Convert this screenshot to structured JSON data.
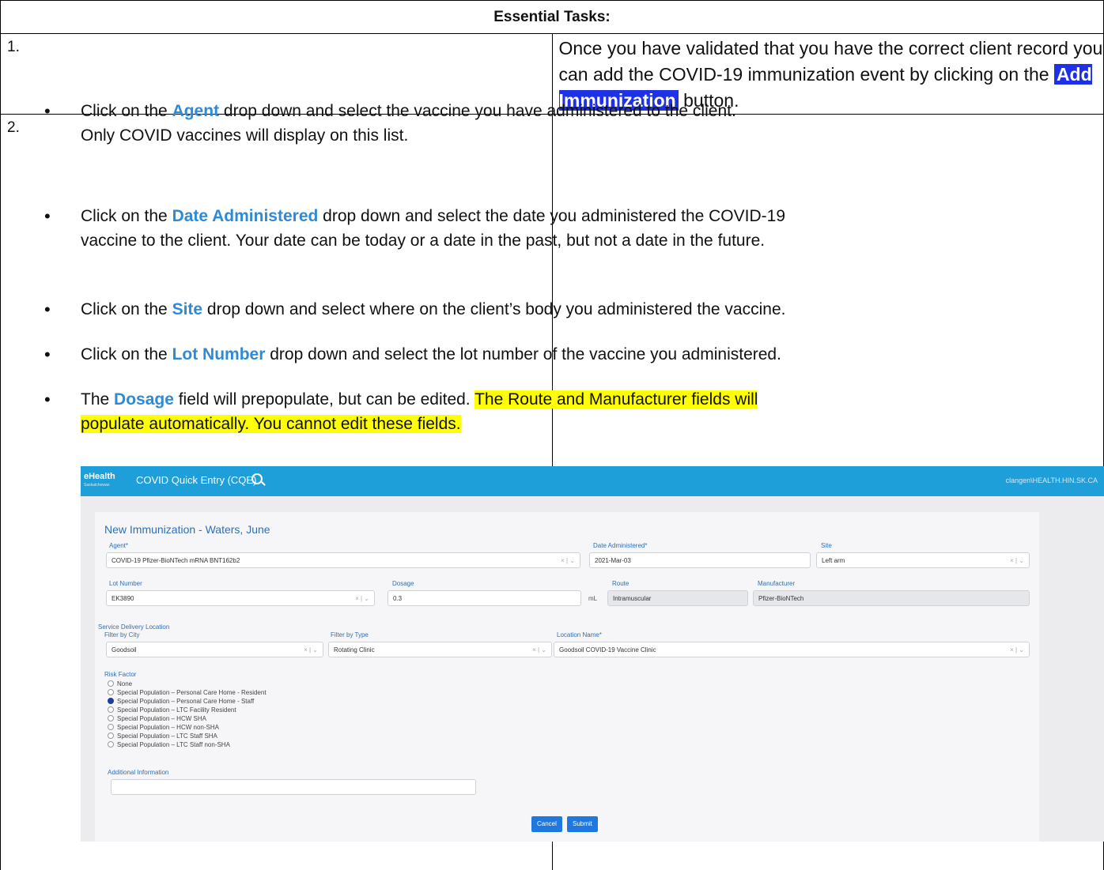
{
  "header": "Essential Tasks:",
  "step1": {
    "number": "1.",
    "text_before": "Once you have validated that you have the correct client record you can add the COVID-19 immunization event by clicking on the ",
    "button": "Add Immunization",
    "text_after": " button."
  },
  "step2": {
    "number": "2.",
    "b1": {
      "pre": "Click on the ",
      "kw": "Agent",
      "post": " drop down and select the vaccine you have administered to the client.",
      "line2": "Only COVID vaccines will display on this list."
    },
    "b2": {
      "pre": "Click on the ",
      "kw": "Date Administered",
      "post": " drop down and select the date you administered the COVID-19",
      "line2": "vaccine to the client.  Your date can be today or a date in the past, but not a date in the future."
    },
    "b3": {
      "pre": "Click on the ",
      "kw": "Site",
      "post": " drop down and select where on the client’s body you administered the vaccine."
    },
    "b4": {
      "pre": "Click on the ",
      "kw": "Lot Number",
      "post": " drop down and select the lot number of the vaccine you administered."
    },
    "b5": {
      "pre": "The ",
      "kw": "Dosage",
      "post": " field will prepopulate, but can be edited.  ",
      "hl1": "The Route and Manufacturer fields will",
      "hl2": "populate automatically.  You cannot edit these fields."
    }
  },
  "app": {
    "logo": "eHealth",
    "logo_sub": "Saskatchewan",
    "title": "COVID Quick Entry (CQE)",
    "user": "clangen\\HEALTH.HIN.SK.CA",
    "form_title": "New Immunization - Waters, June",
    "agent_label": "Agent*",
    "agent_value": "COVID-19 Pfizer-BioNTech mRNA BNT162b2",
    "date_label": "Date Administered*",
    "date_value": "2021-Mar-03",
    "site_label": "Site",
    "site_value": "Left arm",
    "lot_label": "Lot Number",
    "lot_value": "EK3890",
    "dosage_label": "Dosage",
    "dosage_value": "0.3",
    "dosage_unit": "mL",
    "route_label": "Route",
    "route_value": "Intramuscular",
    "mfr_label": "Manufacturer",
    "mfr_value": "Pfizer-BioNTech",
    "sdl_label": "Service Delivery Location",
    "city_label": "Filter by City",
    "city_value": "Goodsoil",
    "type_label": "Filter by Type",
    "type_value": "Rotating Clinic",
    "loc_label": "Location Name*",
    "loc_value": "Goodsoil COVID-19 Vaccine Clinic",
    "risk_label": "Risk Factor",
    "risk_options": [
      "None",
      "Special Population – Personal Care Home - Resident",
      "Special Population – Personal Care Home - Staff",
      "Special Population – LTC Facility Resident",
      "Special Population – HCW SHA",
      "Special Population – HCW non-SHA",
      "Special Population – LTC Staff SHA",
      "Special Population – LTC Staff non-SHA"
    ],
    "risk_selected_index": 2,
    "addl_label": "Additional Information",
    "cancel": "Cancel",
    "submit": "Submit"
  }
}
